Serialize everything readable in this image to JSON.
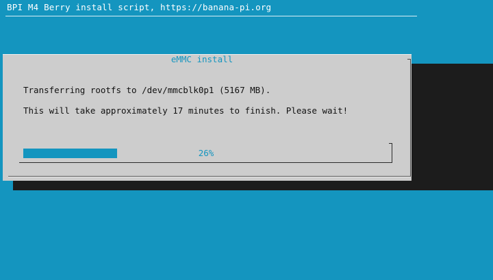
{
  "backtitle": "BPI M4 Berry install script, https://banana-pi.org",
  "dialog": {
    "title": "eMMC install",
    "line1": "Transferring rootfs to /dev/mmcblk0p1 (5167 MB).",
    "line2": "This will take approximately 17 minutes to finish. Please wait!"
  },
  "gauge": {
    "percent": 26,
    "label": "26%",
    "color": "#1495bf"
  },
  "colors": {
    "background": "#1495bf",
    "dialog": "#cdcdcd",
    "shadow": "#1c1c1c"
  }
}
